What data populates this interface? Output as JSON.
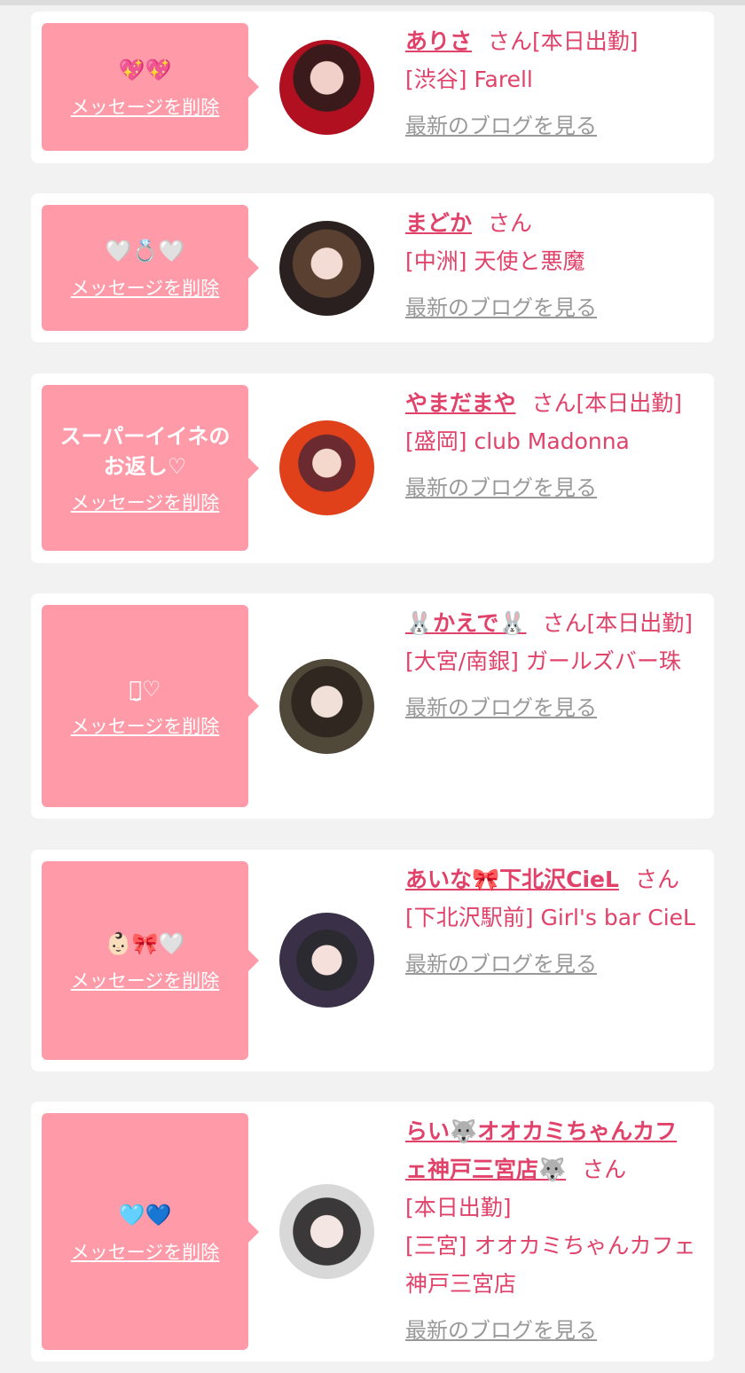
{
  "items": [
    {
      "message": "💖💖",
      "delete_label": "メッセージを削除",
      "name": "ありさ",
      "honorific": "さん",
      "status": "[本日出勤]",
      "shop": "[渋谷] Farell",
      "blog_label": "最新のブログを見る"
    },
    {
      "message": "🤍💍🤍",
      "delete_label": "メッセージを削除",
      "name": "まどか",
      "honorific": "さん",
      "status": "",
      "shop": "[中洲] 天使と悪魔",
      "blog_label": "最新のブログを見る"
    },
    {
      "message": "スーパーイイネのお返し♡",
      "delete_label": "メッセージを削除",
      "name": "やまだまや",
      "honorific": "さん",
      "status": "[本日出勤]",
      "shop": "[盛岡] club Madonna",
      "blog_label": "最新のブログを見る"
    },
    {
      "message": "ꪔ̤̮♡",
      "delete_label": "メッセージを削除",
      "name": "🐰かえで🐰",
      "honorific": "さん",
      "status": "[本日出勤]",
      "shop": "[大宮/南銀] ガールズバー珠",
      "blog_label": "最新のブログを見る"
    },
    {
      "message": "👶🏻🎀🤍",
      "delete_label": "メッセージを削除",
      "name": "あいな🎀下北沢CieL",
      "honorific": "さん",
      "status": "",
      "shop": "[下北沢駅前] Girl's bar CieL",
      "blog_label": "最新のブログを見る"
    },
    {
      "message": "🩵💙",
      "delete_label": "メッセージを削除",
      "name": "らい🐺オオカミちゃんカフェ神戸三宮店🐺",
      "honorific": "さん",
      "status": "[本日出勤]",
      "shop": "[三宮] オオカミちゃんカフェ神戸三宮店",
      "blog_label": "最新のブログを見る"
    }
  ]
}
